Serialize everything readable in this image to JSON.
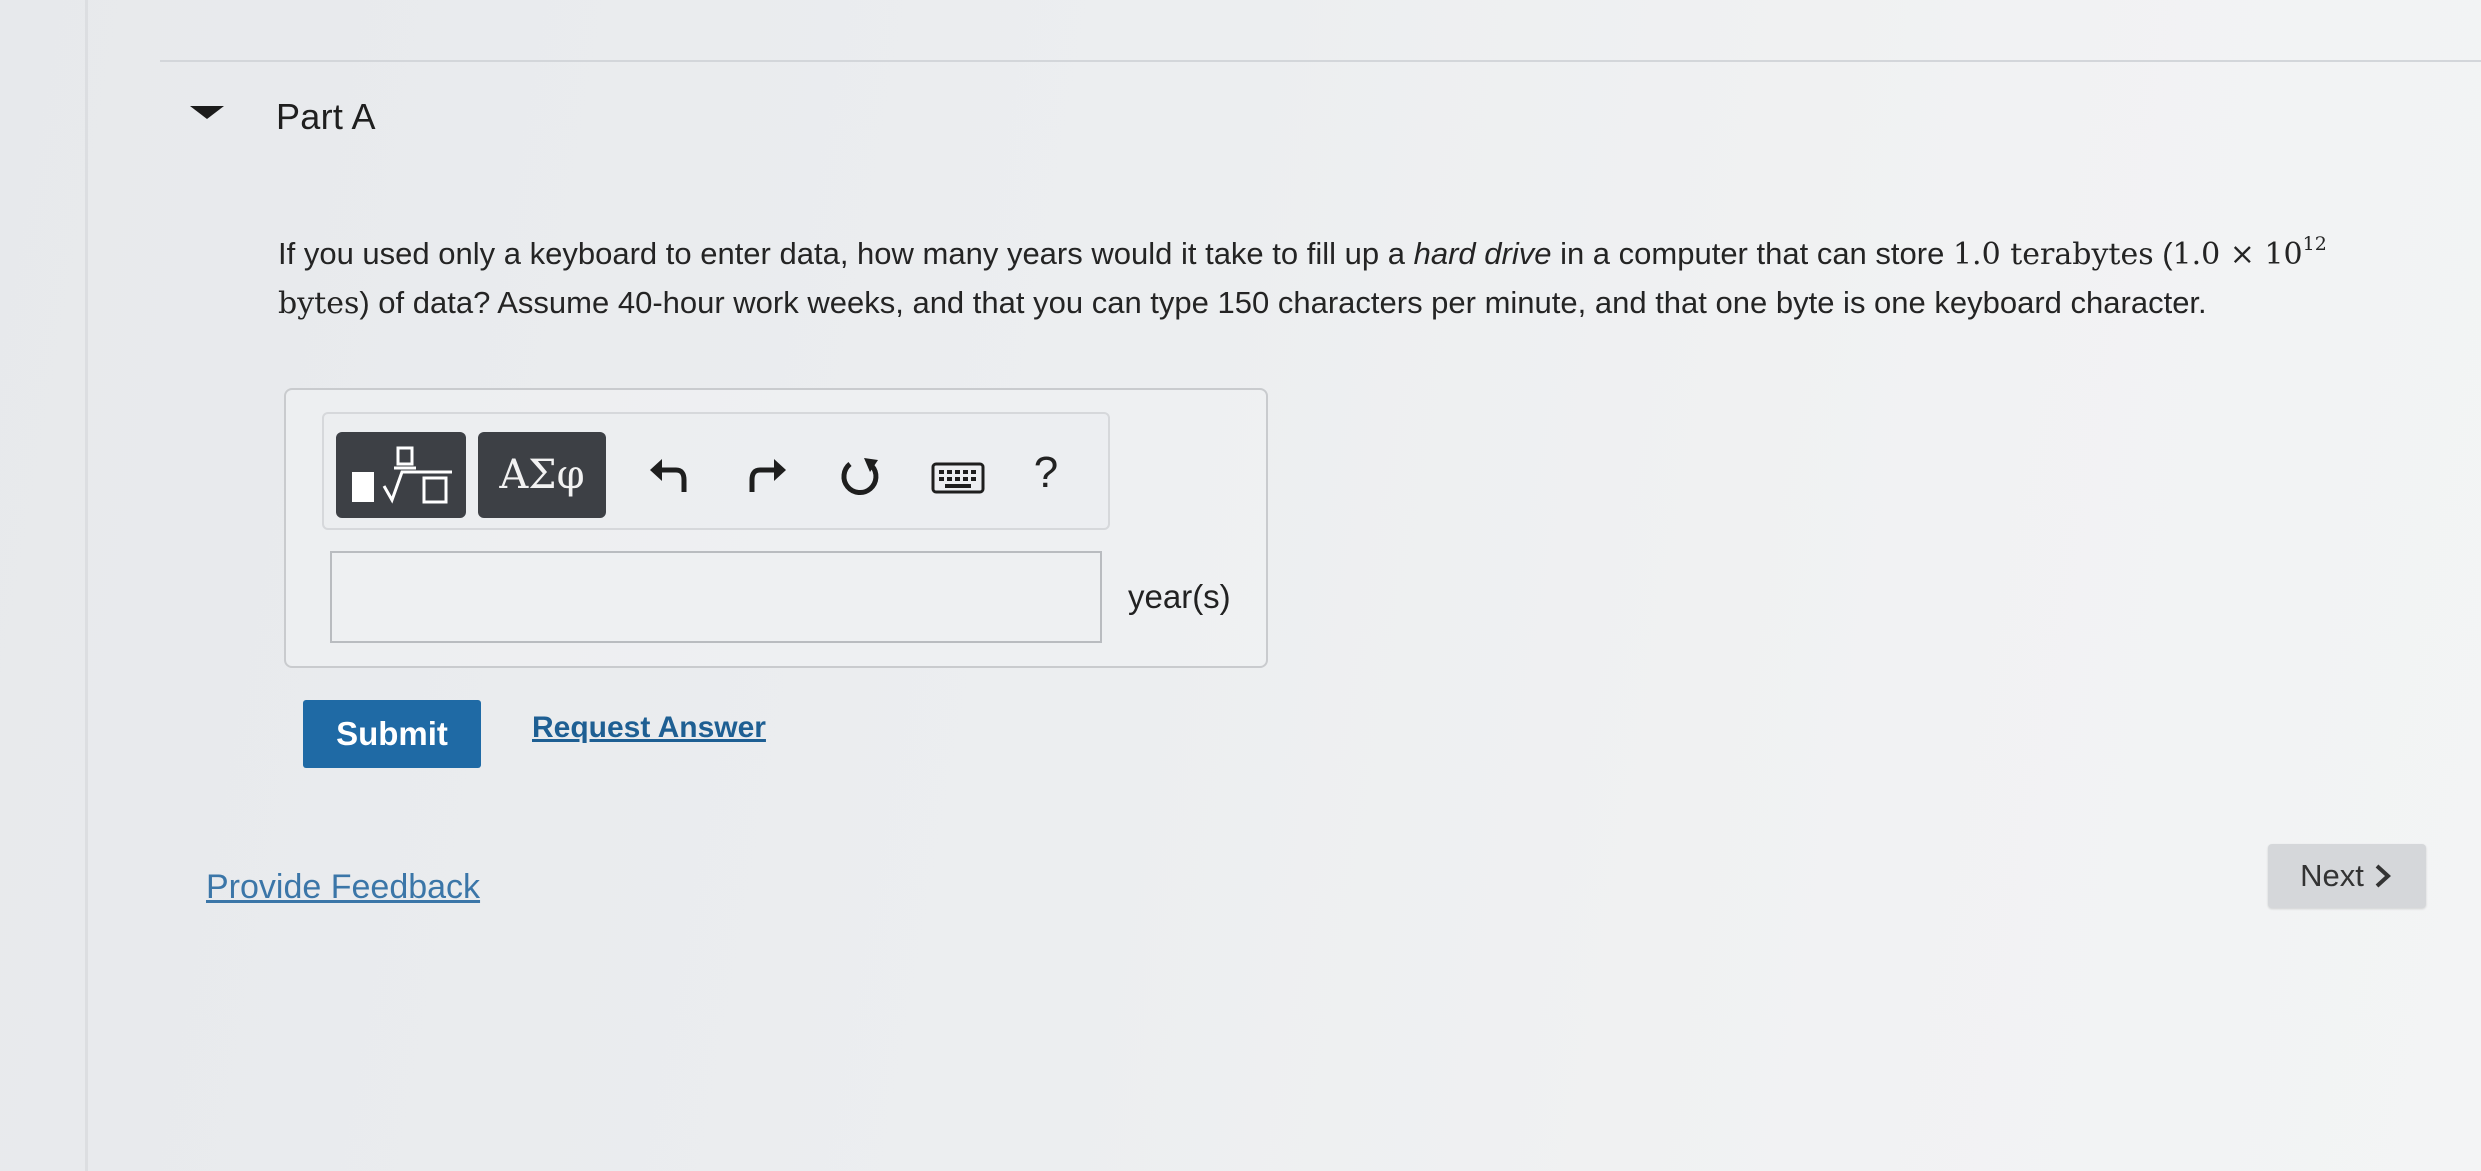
{
  "part": {
    "title": "Part A",
    "toggle_icon": "triangle-down-icon"
  },
  "question": {
    "text_1": "If you used only a keyboard to enter data, how many years would it take to fill up a ",
    "text_italic": "hard drive",
    "text_2": " in a computer that can store ",
    "math_1": "1.0 terabytes",
    "text_3": " (",
    "math_2": "1.0 × 10",
    "math_2_exp": "12",
    "math_3": " bytes",
    "text_4": ") of data? Assume 40-hour work weeks, and that you can type 150 characters per minute, and that one byte is one keyboard character."
  },
  "toolbar": {
    "template_icon": "fraction-root-template-icon",
    "greek_label": "ΑΣφ",
    "undo_icon": "undo-icon",
    "redo_icon": "redo-icon",
    "reset_icon": "reset-icon",
    "keyboard_icon": "keyboard-icon",
    "help_label": "?"
  },
  "answer": {
    "value": "",
    "placeholder": "",
    "units": "year(s)"
  },
  "actions": {
    "submit_label": "Submit",
    "request_answer_label": "Request Answer"
  },
  "footer": {
    "feedback_label": "Provide Feedback",
    "next_label": "Next",
    "next_icon": "chevron-right-icon"
  },
  "colors": {
    "submit_bg": "#1f6aa5",
    "link": "#1e5f93",
    "toolbar_dark": "#3d4045"
  }
}
